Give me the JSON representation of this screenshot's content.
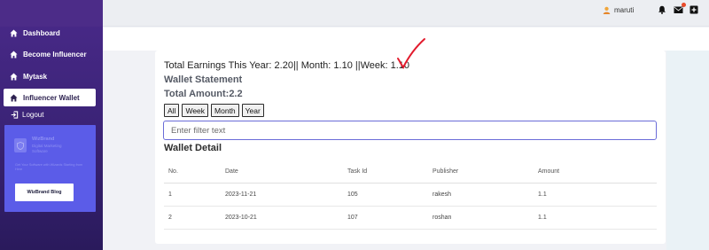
{
  "sidebar": {
    "items": [
      {
        "label": "Dashboard",
        "icon": "home-icon"
      },
      {
        "label": "Become Influencer",
        "icon": "home-icon"
      },
      {
        "label": "Mytask",
        "icon": "home-icon"
      },
      {
        "label": "Influencer Wallet",
        "icon": "home-icon",
        "active": true
      }
    ],
    "logout_label": "Logout",
    "promo": {
      "title": "WizBrand",
      "subtitle": "Digital Marketing Software",
      "description": "Get Your Software with Wizards Starting from Here",
      "button_label": "WizBrand Blog",
      "bg_color": "#5b5ce8"
    }
  },
  "header": {
    "username": "maruti"
  },
  "main": {
    "earnings_text": "Total Earnings This Year: 2.20|| Month: 1.10 ||Week: 1.10",
    "wallet_statement_title": "Wallet Statement",
    "total_amount": "Total Amount:2.2",
    "filter_buttons": [
      "All",
      "Week",
      "Month",
      "Year"
    ],
    "filter_placeholder": "Enter filter text",
    "detail_title": "Wallet Detail",
    "table": {
      "headers": [
        "No.",
        "Date",
        "Task Id",
        "Publisher",
        "Amount"
      ],
      "rows": [
        [
          "1",
          "2023-11-21",
          "105",
          "rakesh",
          "1.1"
        ],
        [
          "2",
          "2023-10-21",
          "107",
          "roshan",
          "1.1"
        ]
      ]
    }
  },
  "colors": {
    "sidebar_top": "#4a2a8a",
    "sidebar_bottom": "#2a1a5c",
    "accent_input_border": "#6a6cd8",
    "checkmark_red": "#e21b2d"
  }
}
